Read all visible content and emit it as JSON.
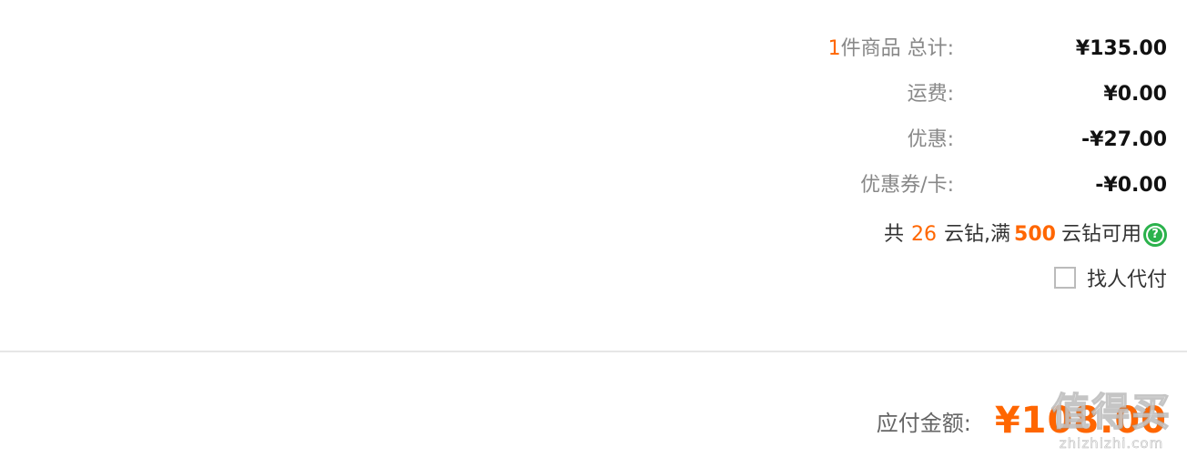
{
  "summary": {
    "item_count": "1",
    "items_total_label": "件商品 总计:",
    "items_total_value": "¥135.00",
    "shipping_label": "运费:",
    "shipping_value": "¥0.00",
    "discount_label": "优惠:",
    "discount_value": "-¥27.00",
    "coupon_label": "优惠券/卡:",
    "coupon_value": "-¥0.00"
  },
  "diamonds": {
    "prefix": "共",
    "count": "26",
    "middle": "云钻,满",
    "threshold": "500",
    "suffix": "云钻可用",
    "help_icon": "question-circle-icon",
    "help_symbol": "?"
  },
  "pay_for_me": {
    "label": "找人代付",
    "checked": false
  },
  "total": {
    "label": "应付金额:",
    "amount": "¥108.00"
  },
  "watermark": {
    "title": "值得买",
    "site": "zhizhizhi.com"
  },
  "colors": {
    "accent": "#ff6600",
    "help_icon": "#2bb24c",
    "divider": "#e6e6e6"
  }
}
